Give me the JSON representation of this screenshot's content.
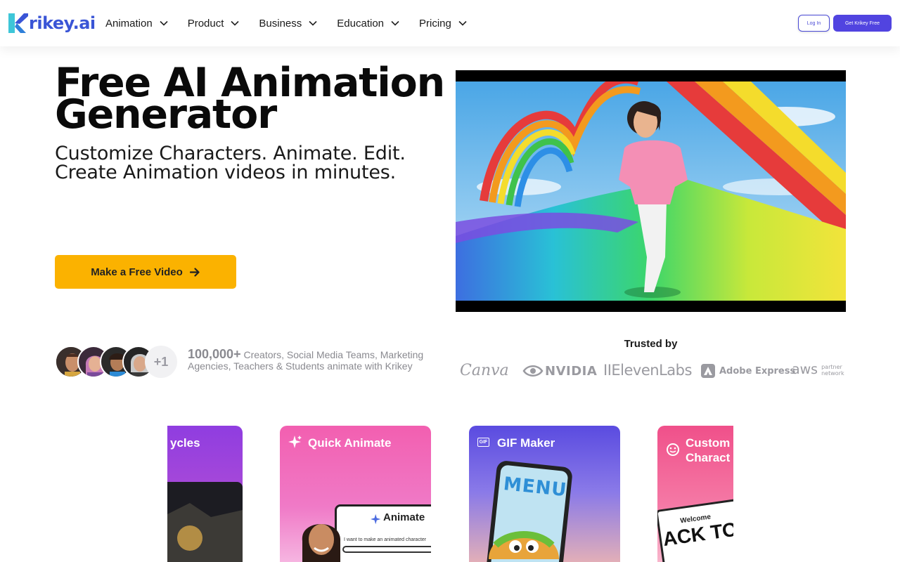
{
  "nav": {
    "logo_k": "K",
    "logo_text": "rikey.ai",
    "items": [
      {
        "label": "Animation"
      },
      {
        "label": "Product"
      },
      {
        "label": "Business"
      },
      {
        "label": "Education"
      },
      {
        "label": "Pricing"
      }
    ],
    "login_label": "Log In",
    "get_label": "Get Krikey Free"
  },
  "hero": {
    "title_line1": "Free AI Animation",
    "title_line2": "Generator",
    "subtitle_line1": "Customize Characters. Animate. Edit.",
    "subtitle_line2": "Create Animation videos in minutes.",
    "cta_label": "Make a Free Video"
  },
  "social": {
    "plus_count": "+1",
    "count": "100,000+",
    "description": " Creators, Social Media Teams, Marketing Agencies, Teachers & Students animate with Krikey"
  },
  "trusted": {
    "heading": "Trusted by",
    "brands": [
      "Canva",
      "NVIDIA",
      "IIElevenLabs",
      "Adobe Express",
      "aws",
      "partner network"
    ]
  },
  "cards": [
    {
      "title": "ycles",
      "icon": "cycle-icon"
    },
    {
      "title": "Quick Animate",
      "icon": "sparkle-icon",
      "inner_label": "Animate",
      "inner_prompt": "I want to make an animated character"
    },
    {
      "title": "GIF Maker",
      "icon": "gif-icon",
      "inner_label": "MENU"
    },
    {
      "title_line1": "Custom",
      "title_line2": "Charact",
      "icon": "smiley-icon",
      "inner_label": "Welcome",
      "inner_big": "ACK TO"
    }
  ],
  "colors": {
    "brand_blue": "#3a55d6",
    "cta_yellow": "#fbb200",
    "primary_button": "#5144e0"
  }
}
